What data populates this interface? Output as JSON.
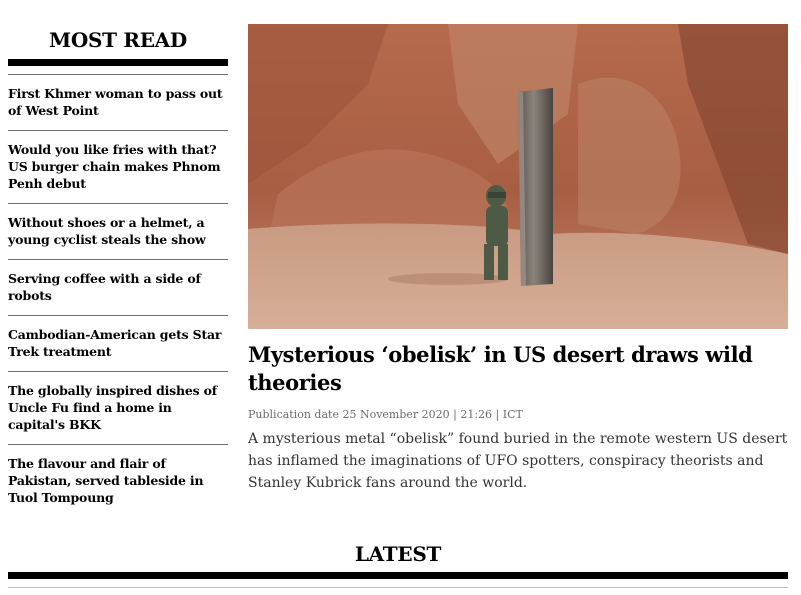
{
  "most_read": {
    "title": "MOST READ",
    "items": [
      {
        "label": "First Khmer woman to pass out of West Point"
      },
      {
        "label": "Would you like fries with that? US burger chain makes Phnom Penh debut"
      },
      {
        "label": "Without shoes or a helmet, a young cyclist steals the show"
      },
      {
        "label": "Serving coffee with a side of robots"
      },
      {
        "label": "Cambodian-American gets Star Trek treatment"
      },
      {
        "label": "The globally inspired dishes of Uncle Fu find a home in capital's BKK"
      },
      {
        "label": "The flavour and flair of Pakistan, served tableside in Tuol Tompoung"
      }
    ]
  },
  "article": {
    "headline": "Mysterious ‘obelisk’ in US desert draws wild theories",
    "pubdate": "Publication date 25 November 2020 | 21:26 | ICT",
    "summary": "A mysterious metal “obelisk” found buried in the remote western US desert has inflamed the imaginations of UFO spotters, conspiracy theorists and Stanley Kubrick fans around the world."
  },
  "latest": {
    "title": "LATEST"
  }
}
